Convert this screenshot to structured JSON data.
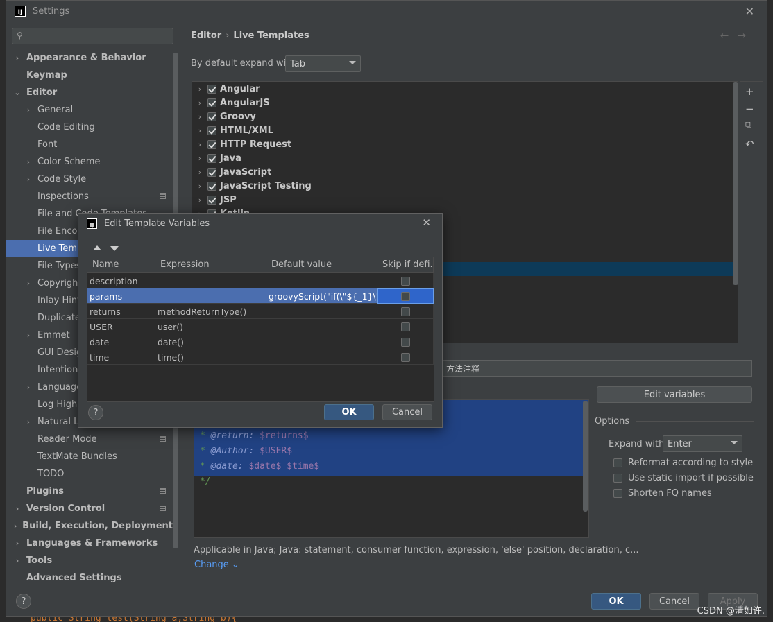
{
  "window": {
    "title": "Settings",
    "logo_text": "IJ"
  },
  "search": {
    "placeholder": ""
  },
  "sidebar": {
    "items": [
      {
        "label": "Appearance & Behavior",
        "level": 0,
        "chevron": "›",
        "bold": true
      },
      {
        "label": "Keymap",
        "level": 0,
        "chevron": "",
        "bold": true
      },
      {
        "label": "Editor",
        "level": 0,
        "chevron": "⌄",
        "bold": true
      },
      {
        "label": "General",
        "level": 1,
        "chevron": "›"
      },
      {
        "label": "Code Editing",
        "level": 1,
        "chevron": ""
      },
      {
        "label": "Font",
        "level": 1,
        "chevron": ""
      },
      {
        "label": "Color Scheme",
        "level": 1,
        "chevron": "›"
      },
      {
        "label": "Code Style",
        "level": 1,
        "chevron": "›"
      },
      {
        "label": "Inspections",
        "level": 1,
        "chevron": "",
        "mark": true
      },
      {
        "label": "File and Code Templates",
        "level": 1,
        "chevron": ""
      },
      {
        "label": "File Encodings",
        "level": 1,
        "chevron": ""
      },
      {
        "label": "Live Templates",
        "level": 1,
        "chevron": "",
        "selected": true
      },
      {
        "label": "File Types",
        "level": 1,
        "chevron": ""
      },
      {
        "label": "Copyright",
        "level": 1,
        "chevron": "›"
      },
      {
        "label": "Inlay Hints",
        "level": 1,
        "chevron": ""
      },
      {
        "label": "Duplicates",
        "level": 1,
        "chevron": ""
      },
      {
        "label": "Emmet",
        "level": 1,
        "chevron": "›"
      },
      {
        "label": "GUI Designer",
        "level": 1,
        "chevron": ""
      },
      {
        "label": "Intentions",
        "level": 1,
        "chevron": ""
      },
      {
        "label": "Language Injections",
        "level": 1,
        "chevron": "›"
      },
      {
        "label": "Log Highlighting",
        "level": 1,
        "chevron": ""
      },
      {
        "label": "Natural Languages",
        "level": 1,
        "chevron": "›"
      },
      {
        "label": "Reader Mode",
        "level": 1,
        "chevron": "",
        "mark": true
      },
      {
        "label": "TextMate Bundles",
        "level": 1,
        "chevron": ""
      },
      {
        "label": "TODO",
        "level": 1,
        "chevron": ""
      },
      {
        "label": "Plugins",
        "level": 0,
        "chevron": "",
        "bold": true,
        "mark": true
      },
      {
        "label": "Version Control",
        "level": 0,
        "chevron": "›",
        "bold": true,
        "mark": true
      },
      {
        "label": "Build, Execution, Deployment",
        "level": 0,
        "chevron": "›",
        "bold": true
      },
      {
        "label": "Languages & Frameworks",
        "level": 0,
        "chevron": "›",
        "bold": true
      },
      {
        "label": "Tools",
        "level": 0,
        "chevron": "›",
        "bold": true
      },
      {
        "label": "Advanced Settings",
        "level": 0,
        "chevron": "",
        "bold": true
      }
    ]
  },
  "breadcrumb": {
    "parent": "Editor",
    "sep": "›",
    "current": "Live Templates"
  },
  "nav": {
    "back": "←",
    "forward": "→"
  },
  "expand_default": {
    "label": "By default expand with",
    "value": "Tab"
  },
  "template_groups": [
    {
      "label": "Angular",
      "checked": true
    },
    {
      "label": "AngularJS",
      "checked": true
    },
    {
      "label": "Groovy",
      "checked": true
    },
    {
      "label": "HTML/XML",
      "checked": true
    },
    {
      "label": "HTTP Request",
      "checked": true
    },
    {
      "label": "Java",
      "checked": true
    },
    {
      "label": "JavaScript",
      "checked": true
    },
    {
      "label": "JavaScript Testing",
      "checked": true
    },
    {
      "label": "JSP",
      "checked": true
    },
    {
      "label": "Kotlin",
      "checked": true
    }
  ],
  "side_tools": {
    "add": "+",
    "remove": "−",
    "copy": "⧉",
    "restore": "↶"
  },
  "description_value": "方法注释",
  "edit_variables_label": "Edit variables",
  "template_text": {
    "lines": [
      {
        "prefix": "* ",
        "tag": "@return:",
        "var": "$returns$"
      },
      {
        "prefix": "* ",
        "tag": "@Author:",
        "var": "$USER$"
      },
      {
        "prefix": "* ",
        "tag": "@date:",
        "var": "$date$ $time$"
      },
      {
        "prefix": "*/",
        "tag": "",
        "var": ""
      }
    ]
  },
  "options": {
    "title": "Options",
    "expand_label": "Expand with",
    "expand_value": "Enter",
    "checks": [
      {
        "label": "Reformat according to style",
        "checked": false
      },
      {
        "label": "Use static import if possible",
        "checked": false
      },
      {
        "label": "Shorten FQ names",
        "checked": false
      }
    ]
  },
  "applicable": "Applicable in Java; Java: statement, consumer function, expression, 'else' position, declaration, c...",
  "change_label": "Change ⌄",
  "footer": {
    "ok": "OK",
    "cancel": "Cancel",
    "apply": "Apply",
    "help": "?"
  },
  "bg_code": "public String test(String a,String b){",
  "watermark": "CSDN @清如许.",
  "dialog": {
    "title": "Edit Template Variables",
    "columns": [
      "Name",
      "Expression",
      "Default value",
      "Skip if defi..."
    ],
    "rows": [
      {
        "name": "description",
        "expression": "",
        "default": "",
        "skip": false
      },
      {
        "name": "params",
        "expression": "",
        "default": "groovyScript(\"if(\\\"${_1}\\\"....",
        "skip": false,
        "selected": true
      },
      {
        "name": "returns",
        "expression": "methodReturnType()",
        "default": "",
        "skip": false
      },
      {
        "name": "USER",
        "expression": "user()",
        "default": "",
        "skip": false
      },
      {
        "name": "date",
        "expression": "date()",
        "default": "",
        "skip": false
      },
      {
        "name": "time",
        "expression": "time()",
        "default": "",
        "skip": false
      }
    ],
    "ok": "OK",
    "cancel": "Cancel",
    "help": "?"
  },
  "colors": {
    "accent": "#4b6eaf",
    "primary_button": "#365880",
    "link": "#589df6"
  }
}
